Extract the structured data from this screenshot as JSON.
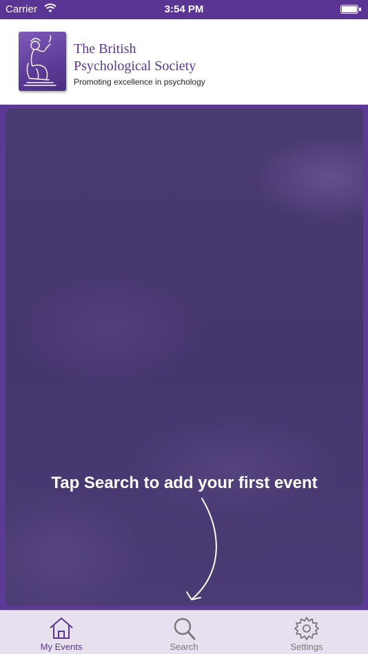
{
  "status_bar": {
    "carrier": "Carrier",
    "time": "3:54 PM"
  },
  "header": {
    "org_name_line1": "The British",
    "org_name_line2": "Psychological Society",
    "tagline": "Promoting excellence in psychology",
    "logo_icon": "bps-logo-icon"
  },
  "main": {
    "empty_hint": "Tap Search to add your first event"
  },
  "tab_bar": {
    "tabs": [
      {
        "label": "My Events",
        "icon": "house-icon",
        "active": true
      },
      {
        "label": "Search",
        "icon": "magnifier-icon",
        "active": false
      },
      {
        "label": "Settings",
        "icon": "gear-icon",
        "active": false
      }
    ]
  },
  "colors": {
    "brand_purple": "#5a3593",
    "tab_bar_bg": "#e6e0ef",
    "tab_inactive": "#777777"
  }
}
